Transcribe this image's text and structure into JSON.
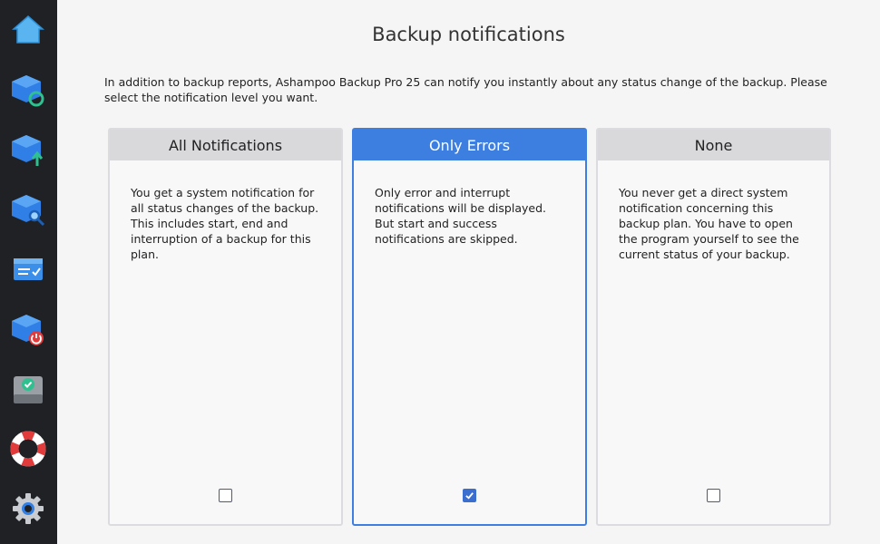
{
  "sidebar": {
    "items": [
      {
        "icon": "home-icon"
      },
      {
        "icon": "backup-restore-icon"
      },
      {
        "icon": "backup-upload-icon"
      },
      {
        "icon": "backup-search-icon"
      },
      {
        "icon": "task-list-icon"
      },
      {
        "icon": "backup-power-icon"
      },
      {
        "icon": "drive-check-icon"
      },
      {
        "icon": "lifebuoy-icon"
      },
      {
        "icon": "gear-icon"
      }
    ]
  },
  "page": {
    "title": "Backup notifications",
    "intro": "In addition to backup reports, Ashampoo Backup Pro 25 can notify you instantly about any status change of the backup. Please select the notification level you want."
  },
  "options": [
    {
      "title": "All Notifications",
      "description": "You get a system notification for all status changes of the backup. This includes start, end and interruption of a backup for this plan.",
      "checked": false
    },
    {
      "title": "Only Errors",
      "description": "Only error and interrupt notifications will be displayed. But start and success notifications are skipped.",
      "checked": true
    },
    {
      "title": "None",
      "description": "You never get a direct system notification concerning this backup plan. You have to open the program yourself to see the current status of your backup.",
      "checked": false
    }
  ],
  "colors": {
    "accent": "#3d7fe0",
    "sidebar_bg": "#1f2124",
    "card_header": "#d9d9dc"
  }
}
